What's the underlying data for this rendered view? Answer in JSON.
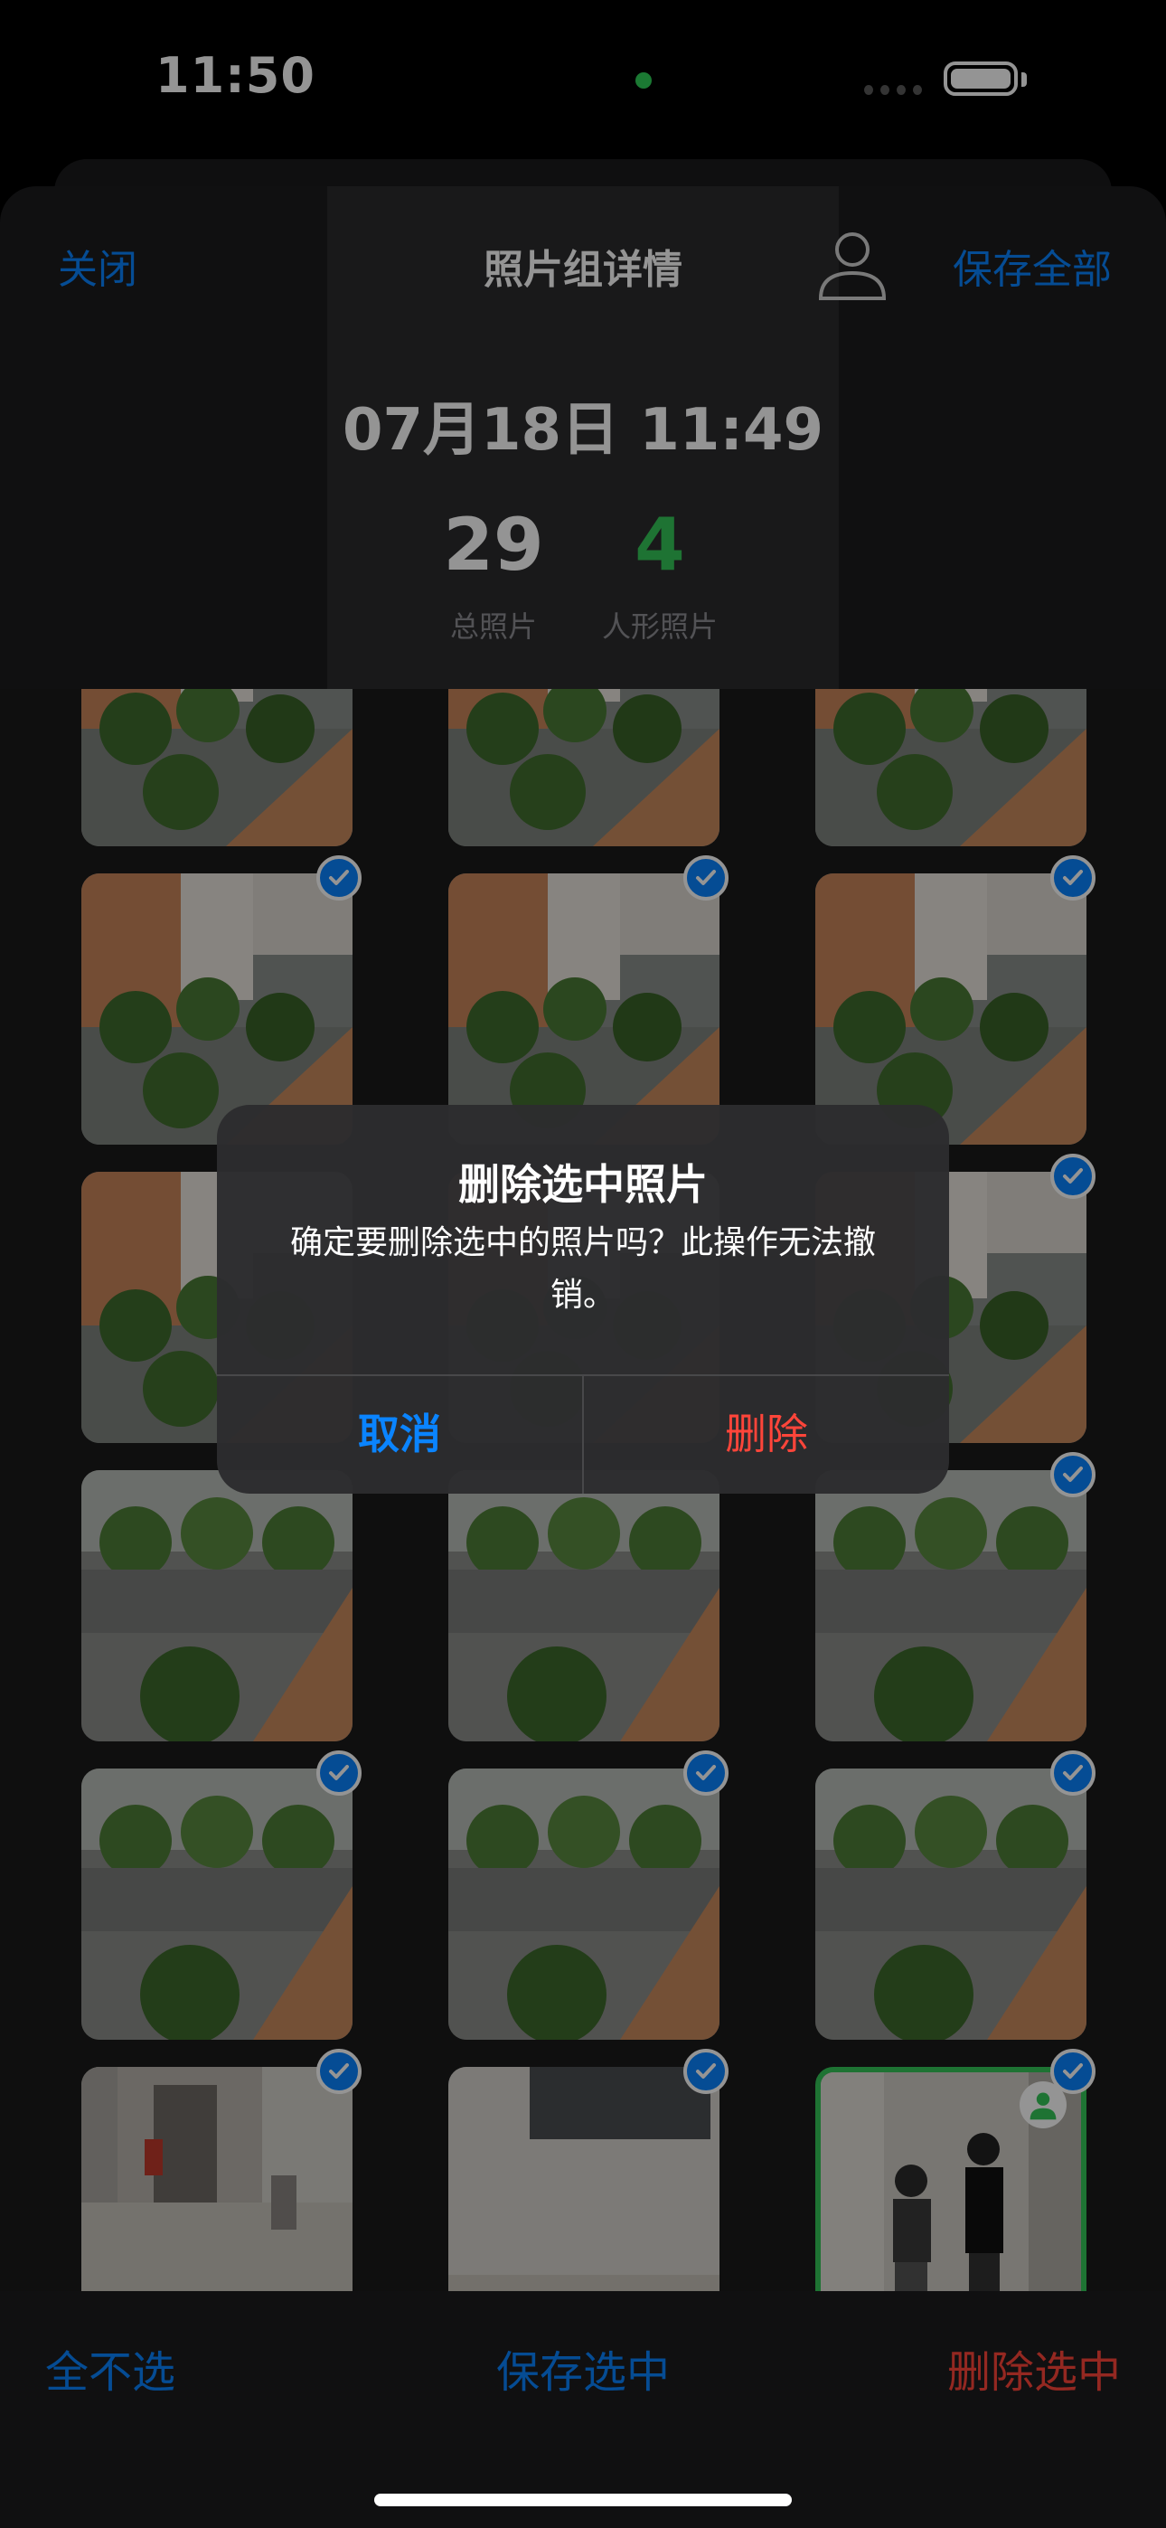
{
  "status_bar": {
    "time": "11:50"
  },
  "nav": {
    "close_label": "关闭",
    "title": "照片组详情",
    "save_all_label": "保存全部",
    "person_icon": "person-icon"
  },
  "summary": {
    "date": "07月18日 11:49",
    "total_count": "29",
    "total_label": "总照片",
    "person_count": "4",
    "person_label": "人形照片"
  },
  "grid": {
    "photos": [
      {
        "scene": "building",
        "selected": false
      },
      {
        "scene": "building",
        "selected": false
      },
      {
        "scene": "building",
        "selected": false
      },
      {
        "scene": "building",
        "selected": true
      },
      {
        "scene": "building",
        "selected": true
      },
      {
        "scene": "building",
        "selected": true
      },
      {
        "scene": "building",
        "selected": false
      },
      {
        "scene": "building",
        "selected": false
      },
      {
        "scene": "building",
        "selected": true
      },
      {
        "scene": "street",
        "selected": false
      },
      {
        "scene": "street",
        "selected": false
      },
      {
        "scene": "street",
        "selected": true
      },
      {
        "scene": "street",
        "selected": true
      },
      {
        "scene": "street",
        "selected": true
      },
      {
        "scene": "street",
        "selected": true
      },
      {
        "scene": "hallway",
        "selected": true
      },
      {
        "scene": "wall",
        "selected": true
      },
      {
        "scene": "people",
        "selected": true,
        "person": true
      }
    ]
  },
  "toolbar": {
    "select_none_label": "全不选",
    "save_selected_label": "保存选中",
    "delete_selected_label": "删除选中"
  },
  "alert": {
    "title": "删除选中照片",
    "message": "确定要删除选中的照片吗？此操作无法撤销。",
    "cancel_label": "取消",
    "delete_label": "删除"
  },
  "colors": {
    "accent": "#0a84ff",
    "destructive": "#ff453a",
    "success": "#34c759"
  }
}
